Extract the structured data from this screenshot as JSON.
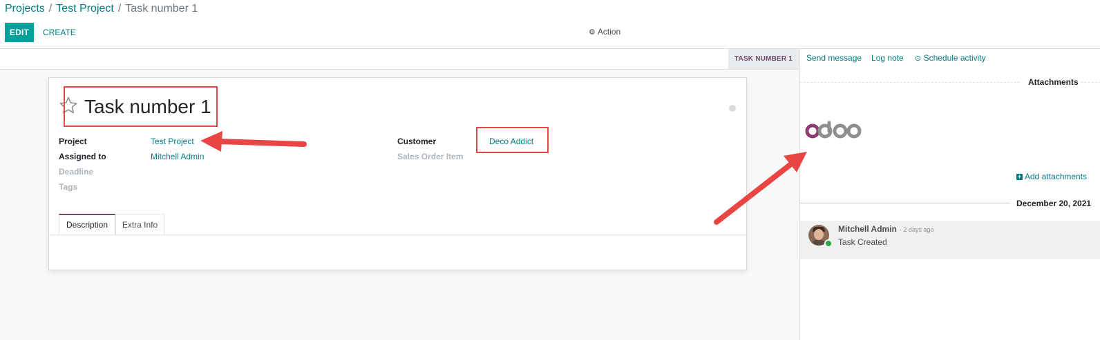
{
  "breadcrumb": {
    "items": [
      "Projects",
      "Test Project"
    ],
    "separator": "/",
    "current": "Task number 1"
  },
  "toolbar": {
    "edit_label": "EDIT",
    "create_label": "CREATE",
    "action_label": "Action"
  },
  "statusbar": {
    "stage": "TASK NUMBER 1"
  },
  "task": {
    "title": "Task number 1",
    "fields_left": [
      {
        "label": "Project",
        "value": "Test Project"
      },
      {
        "label": "Assigned to",
        "value": "Mitchell Admin"
      },
      {
        "label": "Deadline",
        "value": ""
      },
      {
        "label": "Tags",
        "value": ""
      }
    ],
    "fields_right": [
      {
        "label": "Customer",
        "value": "Deco Addict"
      },
      {
        "label": "Sales Order Item",
        "value": ""
      }
    ],
    "tabs": [
      "Description",
      "Extra Info"
    ]
  },
  "chatter": {
    "send_message": "Send message",
    "log_note": "Log note",
    "schedule_activity": "Schedule activity",
    "attachments_title": "Attachments",
    "logo_text": "odoo",
    "add_attachments": "Add attachments",
    "date_separator": "December 20, 2021",
    "messages": [
      {
        "author": "Mitchell Admin",
        "date": "- 2 days ago",
        "body": "Task Created"
      }
    ]
  },
  "colors": {
    "accent_teal": "#017e84",
    "edit_button": "#00a09d",
    "brand_purple": "#714b67",
    "annotation_red": "#ea4545"
  }
}
